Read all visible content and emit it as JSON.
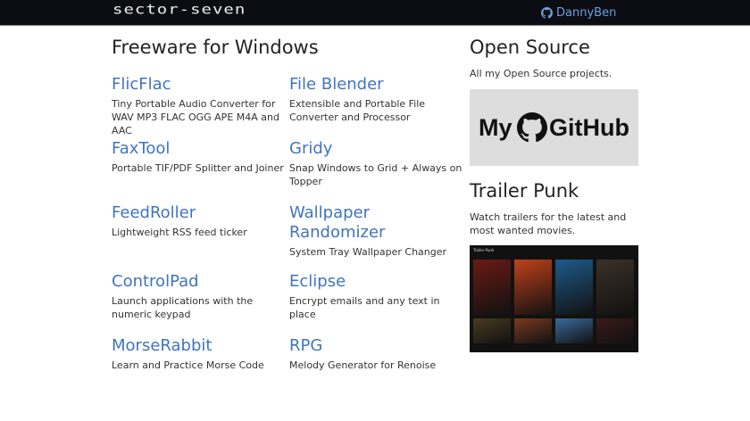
{
  "header": {
    "logo": "sector-seven",
    "user": "DannyBen"
  },
  "main": {
    "title": "Freeware for Windows",
    "items": [
      {
        "name": "FlicFlac",
        "desc": "Tiny Portable Audio Converter for WAV MP3 FLAC OGG APE M4A and AAC"
      },
      {
        "name": "File Blender",
        "desc": "Extensible and Portable File Converter and Processor"
      },
      {
        "name": "FaxTool",
        "desc": "Portable TIF/PDF Splitter and Joiner"
      },
      {
        "name": "Gridy",
        "desc": "Snap Windows to Grid + Always on Topper"
      },
      {
        "name": "FeedRoller",
        "desc": "Lightweight RSS feed ticker"
      },
      {
        "name": "Wallpaper Randomizer",
        "desc": "System Tray Wallpaper Changer"
      },
      {
        "name": "ControlPad",
        "desc": "Launch applications with the numeric keypad"
      },
      {
        "name": "Eclipse",
        "desc": "Encrypt emails and any text in place"
      },
      {
        "name": "MorseRabbit",
        "desc": "Learn and Practice Morse Code"
      },
      {
        "name": "RPG",
        "desc": "Melody Generator for Renoise"
      }
    ]
  },
  "side": {
    "open_title": "Open Source",
    "open_desc": "All my Open Source projects.",
    "github_label": "My GitHub",
    "trailer_title": "Trailer Punk",
    "trailer_desc": "Watch trailers for the latest and most wanted movies.",
    "trailer_bar": "Trailer Punk",
    "poster_colors": [
      "#6a1a14",
      "#c0401a",
      "#1e5a8a",
      "#3a3028",
      "#4a3a20",
      "#7a3a20",
      "#3a6a9a",
      "#3a1a18"
    ]
  }
}
